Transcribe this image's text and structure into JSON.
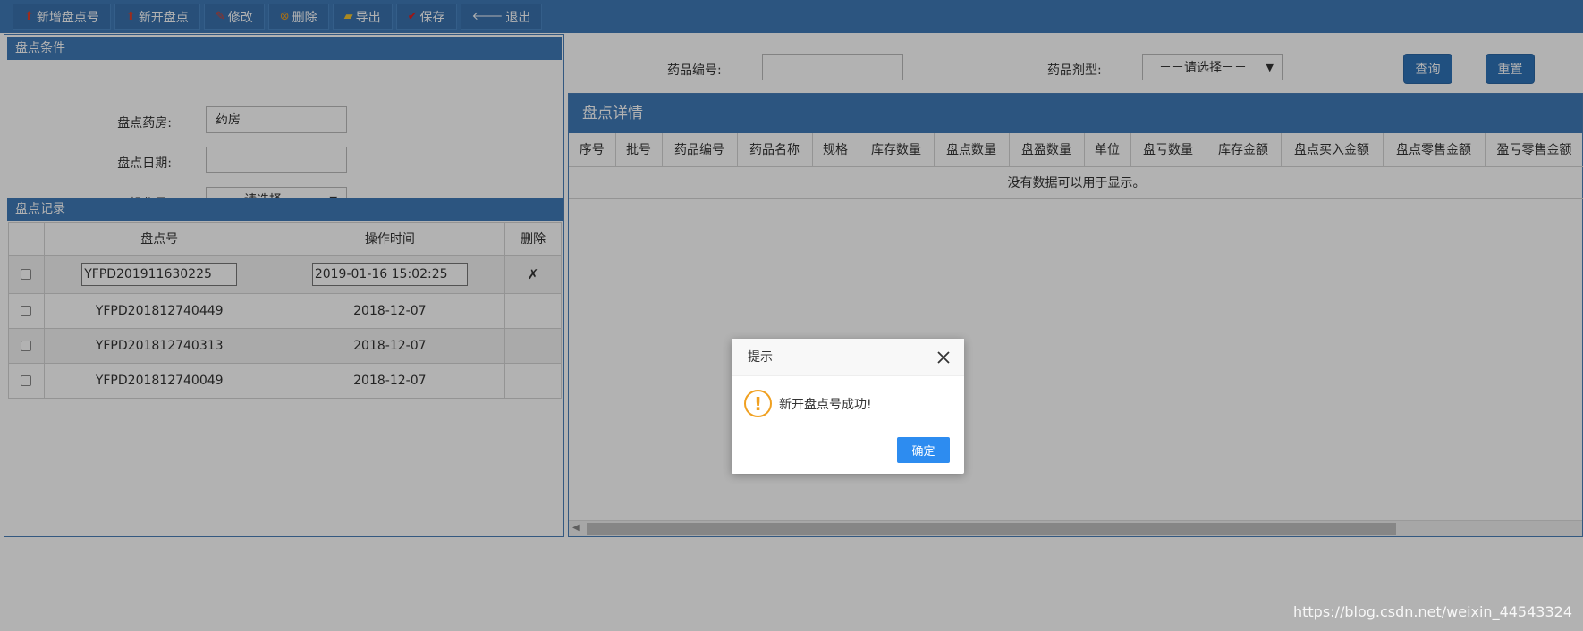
{
  "toolbar": {
    "buttons": [
      {
        "label": "新增盘点号",
        "icon": "upload-icon"
      },
      {
        "label": "新开盘点",
        "icon": "upload-icon"
      },
      {
        "label": "修改",
        "icon": "pencil-icon"
      },
      {
        "label": "删除",
        "icon": "delete-circle-icon"
      },
      {
        "label": "导出",
        "icon": "folder-open-icon"
      },
      {
        "label": "保存",
        "icon": "check-icon"
      },
      {
        "label": "退出",
        "icon": "arrow-left-icon"
      }
    ]
  },
  "conditions": {
    "header": "盘点条件",
    "pharmacy_label": "盘点药房:",
    "pharmacy_value": "药房",
    "date_label": "盘点日期:",
    "date_value": "",
    "operator_label": "操作员:",
    "operator_value": "－－请选择－－"
  },
  "records": {
    "header": "盘点记录",
    "columns": [
      "",
      "盘点号",
      "操作时间",
      "删除"
    ],
    "rows": [
      {
        "id": "YFPD201911630225",
        "time": "2019-01-16 15:02:25",
        "delete": "✗",
        "editing": true
      },
      {
        "id": "YFPD201812740449",
        "time": "2018-12-07",
        "delete": ""
      },
      {
        "id": "YFPD201812740313",
        "time": "2018-12-07",
        "delete": ""
      },
      {
        "id": "YFPD201812740049",
        "time": "2018-12-07",
        "delete": ""
      }
    ]
  },
  "filters": {
    "drug_code_label": "药品编号:",
    "drug_code_value": "",
    "dosage_label": "药品剂型:",
    "dosage_value": "－－请选择－－",
    "query_label": "查询",
    "reset_label": "重置"
  },
  "detail": {
    "header": "盘点详情",
    "columns": [
      "序号",
      "批号",
      "药品编号",
      "药品名称",
      "规格",
      "库存数量",
      "盘点数量",
      "盘盈数量",
      "单位",
      "盘亏数量",
      "库存金额",
      "盘点买入金额",
      "盘点零售金额",
      "盈亏零售金额"
    ],
    "empty_text": "没有数据可以用于显示。"
  },
  "dialog": {
    "title": "提示",
    "message": "新开盘点号成功!",
    "ok_label": "确定"
  },
  "watermark": "https://blog.csdn.net/weixin_44543324",
  "colors": {
    "header_blue": "#3f7ab8",
    "button_blue": "#2f73b8",
    "dialog_ok": "#2d8cf0",
    "warning": "#f0a020"
  }
}
